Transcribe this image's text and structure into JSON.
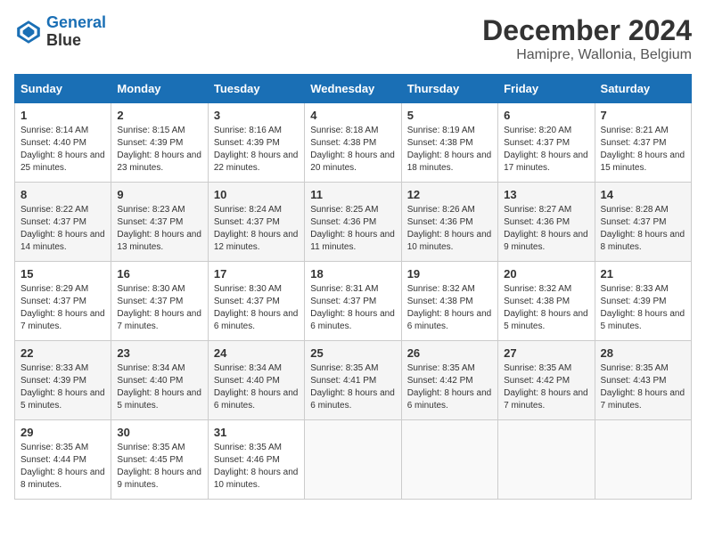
{
  "logo": {
    "line1": "General",
    "line2": "Blue"
  },
  "title": "December 2024",
  "subtitle": "Hamipre, Wallonia, Belgium",
  "weekdays": [
    "Sunday",
    "Monday",
    "Tuesday",
    "Wednesday",
    "Thursday",
    "Friday",
    "Saturday"
  ],
  "weeks": [
    [
      {
        "day": "1",
        "sunrise": "8:14 AM",
        "sunset": "4:40 PM",
        "daylight": "8 hours and 25 minutes."
      },
      {
        "day": "2",
        "sunrise": "8:15 AM",
        "sunset": "4:39 PM",
        "daylight": "8 hours and 23 minutes."
      },
      {
        "day": "3",
        "sunrise": "8:16 AM",
        "sunset": "4:39 PM",
        "daylight": "8 hours and 22 minutes."
      },
      {
        "day": "4",
        "sunrise": "8:18 AM",
        "sunset": "4:38 PM",
        "daylight": "8 hours and 20 minutes."
      },
      {
        "day": "5",
        "sunrise": "8:19 AM",
        "sunset": "4:38 PM",
        "daylight": "8 hours and 18 minutes."
      },
      {
        "day": "6",
        "sunrise": "8:20 AM",
        "sunset": "4:37 PM",
        "daylight": "8 hours and 17 minutes."
      },
      {
        "day": "7",
        "sunrise": "8:21 AM",
        "sunset": "4:37 PM",
        "daylight": "8 hours and 15 minutes."
      }
    ],
    [
      {
        "day": "8",
        "sunrise": "8:22 AM",
        "sunset": "4:37 PM",
        "daylight": "8 hours and 14 minutes."
      },
      {
        "day": "9",
        "sunrise": "8:23 AM",
        "sunset": "4:37 PM",
        "daylight": "8 hours and 13 minutes."
      },
      {
        "day": "10",
        "sunrise": "8:24 AM",
        "sunset": "4:37 PM",
        "daylight": "8 hours and 12 minutes."
      },
      {
        "day": "11",
        "sunrise": "8:25 AM",
        "sunset": "4:36 PM",
        "daylight": "8 hours and 11 minutes."
      },
      {
        "day": "12",
        "sunrise": "8:26 AM",
        "sunset": "4:36 PM",
        "daylight": "8 hours and 10 minutes."
      },
      {
        "day": "13",
        "sunrise": "8:27 AM",
        "sunset": "4:36 PM",
        "daylight": "8 hours and 9 minutes."
      },
      {
        "day": "14",
        "sunrise": "8:28 AM",
        "sunset": "4:37 PM",
        "daylight": "8 hours and 8 minutes."
      }
    ],
    [
      {
        "day": "15",
        "sunrise": "8:29 AM",
        "sunset": "4:37 PM",
        "daylight": "8 hours and 7 minutes."
      },
      {
        "day": "16",
        "sunrise": "8:30 AM",
        "sunset": "4:37 PM",
        "daylight": "8 hours and 7 minutes."
      },
      {
        "day": "17",
        "sunrise": "8:30 AM",
        "sunset": "4:37 PM",
        "daylight": "8 hours and 6 minutes."
      },
      {
        "day": "18",
        "sunrise": "8:31 AM",
        "sunset": "4:37 PM",
        "daylight": "8 hours and 6 minutes."
      },
      {
        "day": "19",
        "sunrise": "8:32 AM",
        "sunset": "4:38 PM",
        "daylight": "8 hours and 6 minutes."
      },
      {
        "day": "20",
        "sunrise": "8:32 AM",
        "sunset": "4:38 PM",
        "daylight": "8 hours and 5 minutes."
      },
      {
        "day": "21",
        "sunrise": "8:33 AM",
        "sunset": "4:39 PM",
        "daylight": "8 hours and 5 minutes."
      }
    ],
    [
      {
        "day": "22",
        "sunrise": "8:33 AM",
        "sunset": "4:39 PM",
        "daylight": "8 hours and 5 minutes."
      },
      {
        "day": "23",
        "sunrise": "8:34 AM",
        "sunset": "4:40 PM",
        "daylight": "8 hours and 5 minutes."
      },
      {
        "day": "24",
        "sunrise": "8:34 AM",
        "sunset": "4:40 PM",
        "daylight": "8 hours and 6 minutes."
      },
      {
        "day": "25",
        "sunrise": "8:35 AM",
        "sunset": "4:41 PM",
        "daylight": "8 hours and 6 minutes."
      },
      {
        "day": "26",
        "sunrise": "8:35 AM",
        "sunset": "4:42 PM",
        "daylight": "8 hours and 6 minutes."
      },
      {
        "day": "27",
        "sunrise": "8:35 AM",
        "sunset": "4:42 PM",
        "daylight": "8 hours and 7 minutes."
      },
      {
        "day": "28",
        "sunrise": "8:35 AM",
        "sunset": "4:43 PM",
        "daylight": "8 hours and 7 minutes."
      }
    ],
    [
      {
        "day": "29",
        "sunrise": "8:35 AM",
        "sunset": "4:44 PM",
        "daylight": "8 hours and 8 minutes."
      },
      {
        "day": "30",
        "sunrise": "8:35 AM",
        "sunset": "4:45 PM",
        "daylight": "8 hours and 9 minutes."
      },
      {
        "day": "31",
        "sunrise": "8:35 AM",
        "sunset": "4:46 PM",
        "daylight": "8 hours and 10 minutes."
      },
      null,
      null,
      null,
      null
    ]
  ]
}
